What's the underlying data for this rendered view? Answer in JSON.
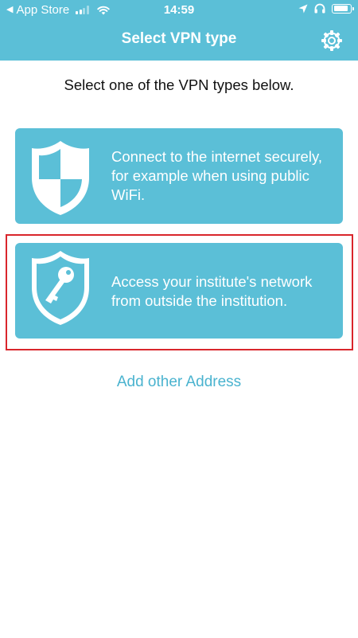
{
  "status_bar": {
    "carrier": "App Store",
    "time": "14:59",
    "battery_level": 0.9,
    "signal_bars": 2,
    "signal_bars_total": 4
  },
  "navbar": {
    "title": "Select VPN type",
    "settings_icon": "gear-icon"
  },
  "main": {
    "instruction": "Select one of the VPN types below.",
    "options": [
      {
        "icon": "shield-checkered-icon",
        "text": "Connect to the internet securely, for example when using public WiFi."
      },
      {
        "icon": "shield-key-icon",
        "text": "Access your institute's network from outside the institution."
      }
    ],
    "add_link": "Add other Address"
  },
  "colors": {
    "accent": "#5bbfd7",
    "link": "#4ab3cf",
    "highlight": "#d9262c",
    "background": "#ffffff"
  }
}
